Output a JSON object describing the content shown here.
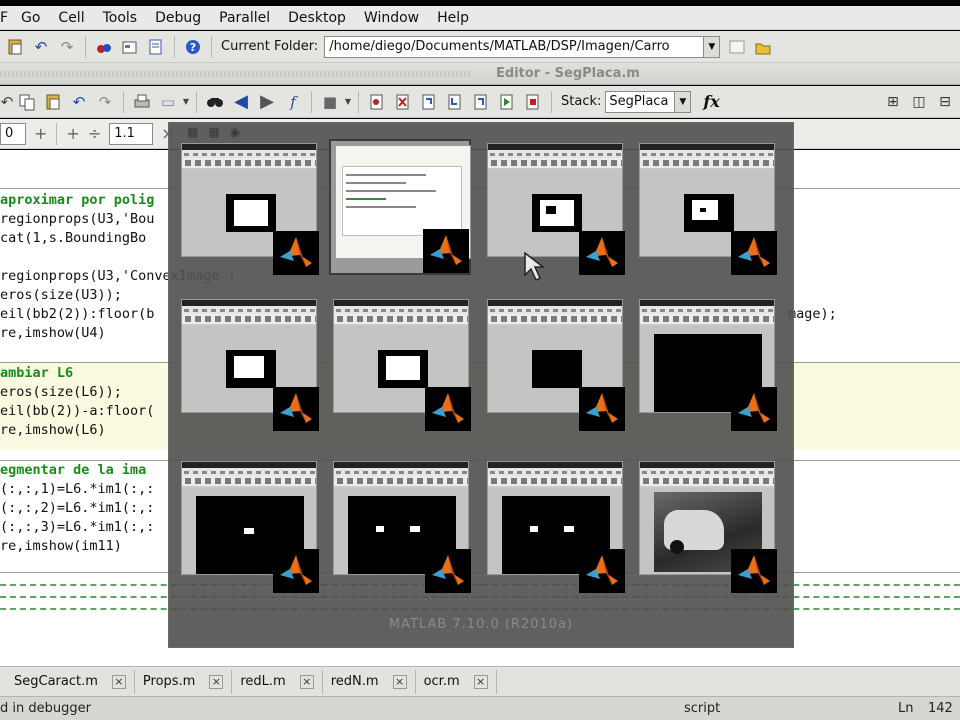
{
  "menubar": {
    "items": [
      {
        "label": "File",
        "key": "F"
      },
      {
        "label": "Go"
      },
      {
        "label": "Cell"
      },
      {
        "label": "Tools"
      },
      {
        "label": "Debug"
      },
      {
        "label": "Parallel"
      },
      {
        "label": "Desktop"
      },
      {
        "label": "Window"
      },
      {
        "label": "Help"
      }
    ]
  },
  "toolbar": {
    "current_folder_label": "Current Folder:",
    "current_folder_value": "/home/diego/Documents/MATLAB/DSP/Imagen/Carro"
  },
  "editor": {
    "title": "Editor - SegPlaca.m",
    "stack_label": "Stack:",
    "stack_value": "SegPlaca",
    "fx_label": "fx"
  },
  "cellbar": {
    "value1": "0",
    "value2": "1.1"
  },
  "code": {
    "lines": [
      {
        "text": "aproximar por polig",
        "comment": true
      },
      {
        "text": "regionprops(U3,'Bou",
        "comment": false
      },
      {
        "text": "cat(1,s.BoundingBo",
        "comment": false
      },
      {
        "text": "regionprops(U3,'ConvexImage')",
        "comment": false
      },
      {
        "text": "eros(size(U3));",
        "comment": false
      },
      {
        "text": "eil(bb2(2)):floor(b",
        "comment": false
      },
      {
        "text": "re,imshow(U4)",
        "comment": false
      },
      {
        "text": "ambiar L6",
        "comment": true
      },
      {
        "text": "eros(size(L6));",
        "comment": false
      },
      {
        "text": "eil(bb(2))-a:floor(",
        "comment": false
      },
      {
        "text": "re,imshow(L6)",
        "comment": false
      },
      {
        "text": "egmentar de la ima",
        "comment": true
      },
      {
        "text": "(:,:,1)=L6.*im1(:,:",
        "comment": false
      },
      {
        "text": "(:,:,2)=L6.*im1(:,:",
        "comment": false
      },
      {
        "text": "(:,:,3)=L6.*im1(:,:",
        "comment": false
      },
      {
        "text": "re,imshow(im11)",
        "comment": false
      }
    ],
    "right_fragment": "mage);"
  },
  "switcher": {
    "caption": "MATLAB 7.10.0 (R2010a)",
    "thumbnails": [
      {
        "kind": "figure",
        "content": "white-rect"
      },
      {
        "kind": "editor",
        "content": "editor"
      },
      {
        "kind": "figure",
        "content": "white-rect-hole"
      },
      {
        "kind": "figure",
        "content": "white-noisy"
      },
      {
        "kind": "figure",
        "content": "white-plate"
      },
      {
        "kind": "figure",
        "content": "white-plate-text"
      },
      {
        "kind": "figure",
        "content": "dark-plate"
      },
      {
        "kind": "figure",
        "content": "black-dots"
      },
      {
        "kind": "figure",
        "content": "black-single"
      },
      {
        "kind": "figure",
        "content": "black-pair"
      },
      {
        "kind": "figure",
        "content": "black-pair2"
      },
      {
        "kind": "figure",
        "content": "car-photo"
      }
    ]
  },
  "tabs": [
    {
      "label": "SegCaract.m"
    },
    {
      "label": "Props.m"
    },
    {
      "label": "redL.m"
    },
    {
      "label": "redN.m"
    },
    {
      "label": "ocr.m"
    }
  ],
  "status": {
    "left": "d in debugger",
    "mid": "script",
    "ln_label": "Ln",
    "ln_value": "142"
  }
}
